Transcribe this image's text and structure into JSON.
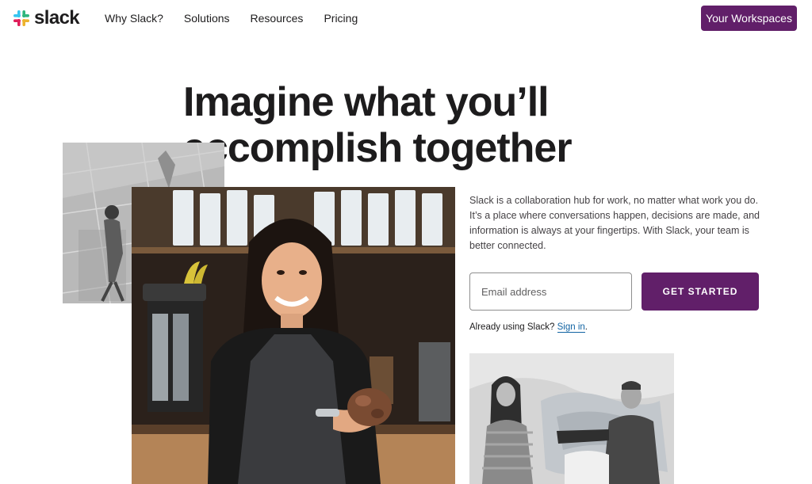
{
  "header": {
    "logo_text": "slack",
    "nav": [
      {
        "label": "Why Slack?"
      },
      {
        "label": "Solutions"
      },
      {
        "label": "Resources"
      },
      {
        "label": "Pricing"
      }
    ],
    "workspaces_label": "Your Workspaces"
  },
  "hero": {
    "headline_line1": "Imagine what you’ll",
    "headline_line2": "accomplish together",
    "description": "Slack is a collaboration hub for work, no matter what work you do. It’s a place where conversations happen, decisions are made, and information is always at your fingertips. With Slack, your team is better connected.",
    "email_placeholder": "Email address",
    "email_value": "",
    "cta_label": "GET STARTED",
    "signin_prefix": "Already using Slack?",
    "signin_link": "Sign in",
    "signin_suffix": "."
  },
  "colors": {
    "brand_aubergine": "#611f69",
    "link_blue": "#1264a3",
    "text_dark": "#1d1c1d",
    "logo_blue": "#36c5f0",
    "logo_green": "#2eb67d",
    "logo_yellow": "#ecb22e",
    "logo_red": "#e01e5a"
  },
  "icons": {
    "logo": "slack-hash-logo-icon"
  }
}
